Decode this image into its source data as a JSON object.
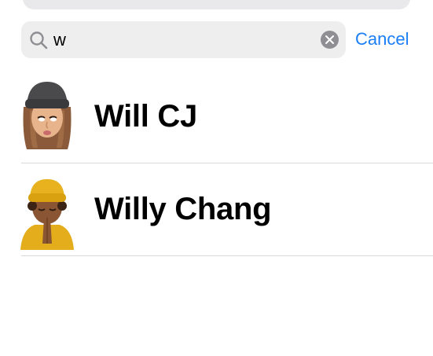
{
  "search": {
    "value": "w",
    "cancel_label": "Cancel"
  },
  "contacts": [
    {
      "name": "Will CJ",
      "avatar": "memoji-beanie-woman"
    },
    {
      "name": "Willy Chang",
      "avatar": "memoji-yellow-hat-praying"
    }
  ],
  "colors": {
    "accent": "#1a7ef5",
    "search_field_bg": "#eeeeef",
    "separator": "#d9d9dc"
  }
}
